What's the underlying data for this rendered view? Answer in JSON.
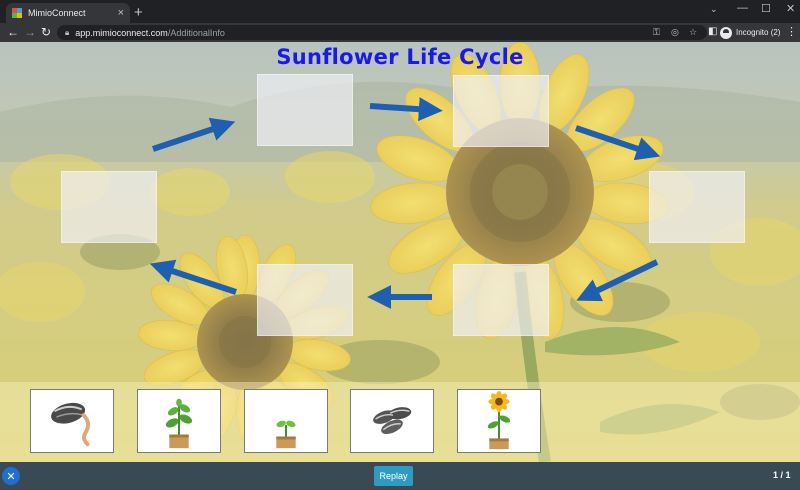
{
  "browser": {
    "tab_title": "MimioConnect",
    "tab_close": "×",
    "new_tab": "+",
    "url_host": "app.mimioconnect.com",
    "url_path": "/AdditionalInfo",
    "profile_label": "Incognito (2)"
  },
  "page": {
    "title": "Sunflower Life Cycle",
    "replay_label": "Replay",
    "page_indicator": "1 / 1",
    "exit_glyph": "✕"
  },
  "slots": [
    "drop-slot-left",
    "drop-slot-top-left",
    "drop-slot-top-right",
    "drop-slot-right",
    "drop-slot-bottom-right",
    "drop-slot-bottom-left"
  ],
  "cards": [
    {
      "name": "card-sprouting-seed",
      "icon": "sprouting-seed-icon"
    },
    {
      "name": "card-young-plant",
      "icon": "young-plant-icon"
    },
    {
      "name": "card-seedling",
      "icon": "seedling-icon"
    },
    {
      "name": "card-seeds",
      "icon": "seeds-icon"
    },
    {
      "name": "card-sunflower",
      "icon": "sunflower-icon"
    }
  ],
  "colors": {
    "title": "#1a1ae6",
    "arrow": "#1f5fb0",
    "replay_button": "#2f9bc0",
    "footer": "#3a4a55"
  }
}
